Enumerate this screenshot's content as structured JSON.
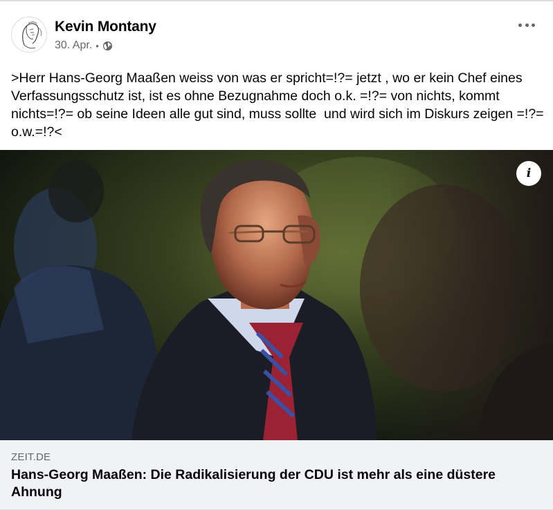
{
  "post": {
    "author": "Kevin Montany",
    "date": "30. Apr.",
    "separator": "•",
    "privacy_icon": "globe-icon",
    "more_icon": "more-options-icon",
    "text": ">Herr Hans-Georg Maaßen weiss von was er spricht=!?= jetzt , wo er kein Chef eines Verfassungsschutz ist, ist es ohne Bezugnahme doch o.k. =!?= von nichts, kommt nichts=!?= ob seine Ideen alle gut sind, muss sollte  und wird sich im Diskurs zeigen =!?=  o.w.=!?<"
  },
  "link_preview": {
    "info_icon": "info-icon",
    "info_label": "i",
    "domain": "ZEIT.DE",
    "title": "Hans-Georg Maaßen: Die Radikalisierung der CDU ist mehr als eine düstere Ahnung"
  },
  "colors": {
    "secondary_text": "#65676b",
    "caption_background": "#f0f2f5",
    "primary_text": "#050505"
  }
}
